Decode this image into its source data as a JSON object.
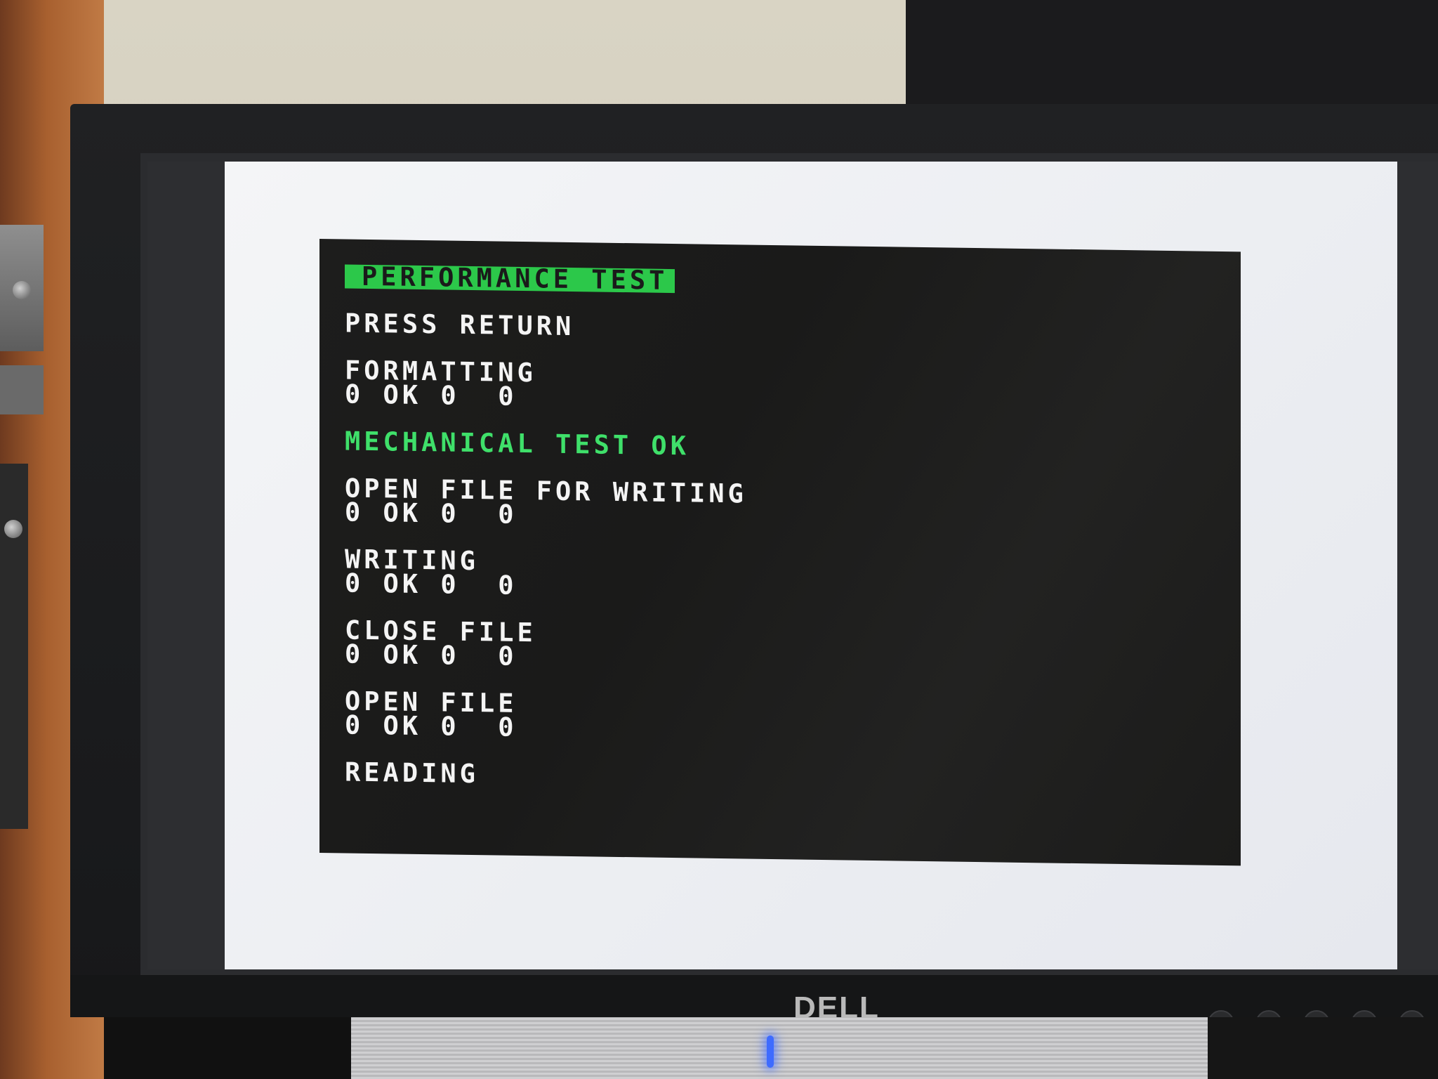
{
  "screen": {
    "title": "PERFORMANCE TEST",
    "prompt": "PRESS RETURN",
    "steps": [
      {
        "label": "FORMATTING",
        "status": "0 OK 0  0"
      },
      {
        "label": "MECHANICAL TEST OK"
      },
      {
        "label": "OPEN FILE FOR WRITING",
        "status": "0 OK 0  0"
      },
      {
        "label": "WRITING",
        "status": "0 OK 0  0"
      },
      {
        "label": "CLOSE FILE",
        "status": "0 OK 0  0"
      },
      {
        "label": "OPEN FILE",
        "status": "0 OK 0  0"
      },
      {
        "label": "READING"
      }
    ],
    "colors": {
      "background": "#1b1b1a",
      "text": "#f4f4f4",
      "accent_green": "#2cc84a"
    }
  },
  "monitor": {
    "brand": "DELL",
    "controls": [
      "input-icon",
      "menu-icon",
      "page-icon",
      "minus-icon",
      "plus-icon"
    ]
  }
}
